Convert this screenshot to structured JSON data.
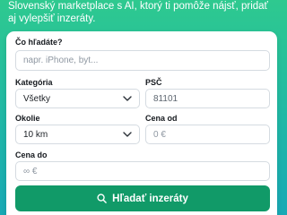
{
  "header": {
    "tagline": "Slovenský marketplace s AI, ktorý ti pomôže nájsť, pridať aj vylepšiť inzeráty."
  },
  "search_form": {
    "query": {
      "label": "Čo hľadáte?",
      "placeholder": "napr. iPhone, byt..."
    },
    "category": {
      "label": "Kategória",
      "value": "Všetky"
    },
    "postal_code": {
      "label": "PSČ",
      "value": "81101"
    },
    "radius": {
      "label": "Okolie",
      "value": "10 km"
    },
    "price_from": {
      "label": "Cena od",
      "placeholder": "0 €"
    },
    "price_to": {
      "label": "Cena do",
      "placeholder": "∞ €"
    },
    "submit_label": "Hľadať inzeráty"
  },
  "colors": {
    "accent": "#119a68",
    "background_top": "#2ec98f",
    "background_bottom": "#18a9b5"
  },
  "icons": {
    "select_arrow": "chevron-down-icon",
    "submit": "search-icon"
  }
}
